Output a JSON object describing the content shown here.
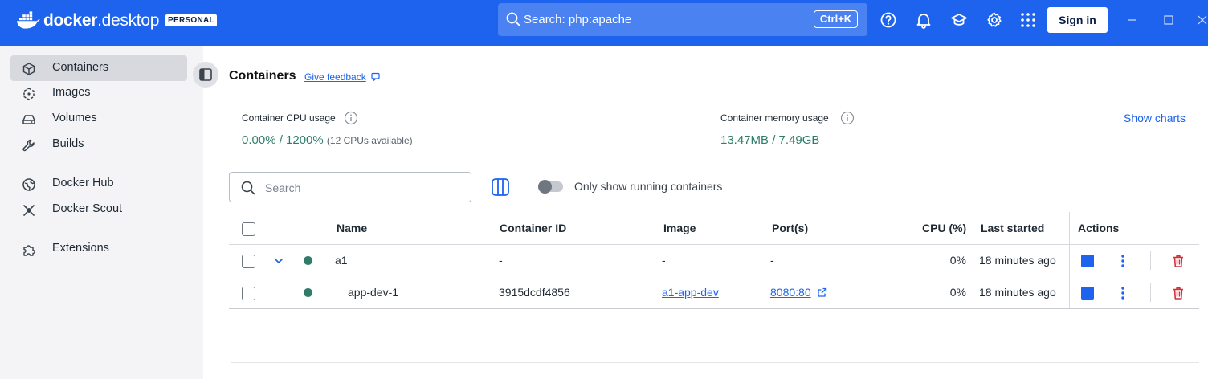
{
  "app": {
    "brand_bold": "docker",
    "brand_light": "desktop",
    "plan": "PERSONAL"
  },
  "topbar": {
    "search_text": "Search: php:apache",
    "shortcut": "Ctrl+K",
    "icons": [
      "help-icon",
      "notifications-bell-icon",
      "learning-center-icon",
      "settings-gear-icon",
      "extensions-grid-icon"
    ],
    "sign_in": "Sign in",
    "window_controls": [
      "minimize-icon",
      "maximize-icon",
      "close-icon"
    ]
  },
  "sidebar": {
    "items": [
      {
        "label": "Containers",
        "icon": "containers-icon",
        "active": true
      },
      {
        "label": "Images",
        "icon": "images-icon"
      },
      {
        "label": "Volumes",
        "icon": "volumes-icon"
      },
      {
        "label": "Builds",
        "icon": "builds-wrench-icon"
      },
      {
        "label": "Docker Hub",
        "icon": "docker-hub-icon"
      },
      {
        "label": "Docker Scout",
        "icon": "docker-scout-icon"
      },
      {
        "label": "Extensions",
        "icon": "extensions-puzzle-icon"
      }
    ]
  },
  "main": {
    "title": "Containers",
    "feedback": "Give feedback",
    "cpu": {
      "label": "Container CPU usage",
      "value": "0.00% / 1200%",
      "note": "(12 CPUs available)"
    },
    "memory": {
      "label": "Container memory usage",
      "value": "13.47MB / 7.49GB"
    },
    "show_charts": "Show charts",
    "search_placeholder": "Search",
    "toggle_label": "Only show running containers",
    "toggle_on": false
  },
  "table": {
    "columns": [
      "Name",
      "Container ID",
      "Image",
      "Port(s)",
      "CPU (%)",
      "Last started",
      "Actions"
    ],
    "rows": [
      {
        "name": "a1",
        "container_id": "-",
        "image": "-",
        "ports": "-",
        "cpu": "0%",
        "last_started": "18 minutes ago",
        "status": "running",
        "group": true
      },
      {
        "name": "app-dev-1",
        "container_id": "3915dcdf4856",
        "image": "a1-app-dev",
        "ports": "8080:80",
        "cpu": "0%",
        "last_started": "18 minutes ago",
        "status": "running",
        "group": false
      }
    ]
  },
  "colors": {
    "brand_blue": "#1d63ed",
    "running_green": "#2f7d69",
    "delete_red": "#d0313b"
  }
}
